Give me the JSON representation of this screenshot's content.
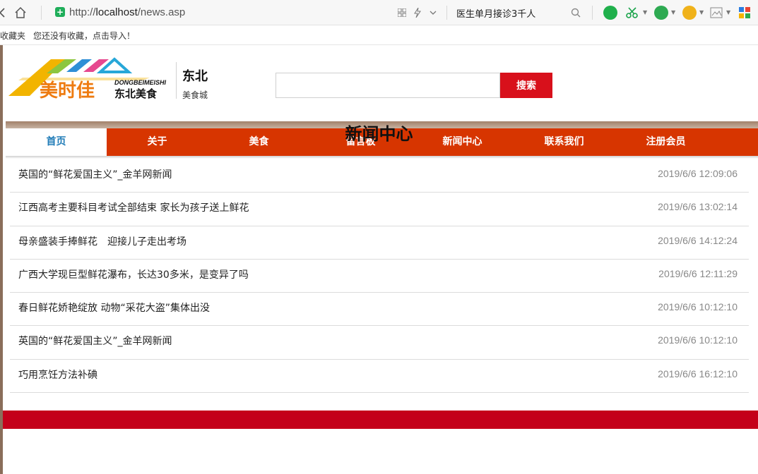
{
  "browser": {
    "url_scheme": "http://",
    "url_host": "localhost",
    "url_path": "/news.asp",
    "search_suggestion": "医生单月接诊3千人",
    "bookmarks_label": "收藏夹",
    "bookmarks_hint": "您还没有收藏，点击导入！"
  },
  "site": {
    "brand_title": "东北",
    "brand_sub": "美食城",
    "logo_cn": "美时佳",
    "logo_pinyin": "DONGBEIMEISHI",
    "logo_sub": "东北美食"
  },
  "search": {
    "placeholder": "",
    "button_label": "搜索"
  },
  "nav": {
    "items": [
      {
        "label": "首页"
      },
      {
        "label": "关于"
      },
      {
        "label": "美食"
      },
      {
        "label": "留言板"
      },
      {
        "label": "新闻中心"
      },
      {
        "label": "联系我们"
      },
      {
        "label": "注册会员"
      }
    ],
    "active_index": 0
  },
  "main": {
    "title": "新闻中心",
    "news": [
      {
        "title": "英国的“鲜花爱国主义”_金羊网新闻",
        "date": "2019/6/6 12:09:06"
      },
      {
        "title": "江西高考主要科目考试全部结束 家长为孩子送上鲜花",
        "date": "2019/6/6 13:02:14"
      },
      {
        "title": "母亲盛装手捧鲜花　迎接儿子走出考场",
        "date": "2019/6/6 14:12:24"
      },
      {
        "title": "广西大学现巨型鲜花瀑布，长达30多米，是变异了吗",
        "date": "2019/6/6 12:11:29"
      },
      {
        "title": "春日鲜花娇艳绽放 动物“采花大盗”集体出没",
        "date": "2019/6/6 10:12:10"
      },
      {
        "title": "英国的“鲜花爱国主义”_金羊网新闻",
        "date": "2019/6/6 10:12:10"
      },
      {
        "title": "巧用烹饪方法补碘",
        "date": "2019/6/6 16:12:10"
      }
    ]
  },
  "colors": {
    "nav_bg": "#d73500",
    "search_btn": "#d8101b",
    "footer": "#c4001a",
    "active_text": "#1f7bb7"
  },
  "icons": {
    "back": "back-arrow-icon",
    "home": "home-icon",
    "secure": "secure-icon",
    "grid": "qr-grid-icon",
    "bolt": "lightning-icon",
    "dropdown": "chevron-down-icon",
    "search": "search-icon"
  }
}
